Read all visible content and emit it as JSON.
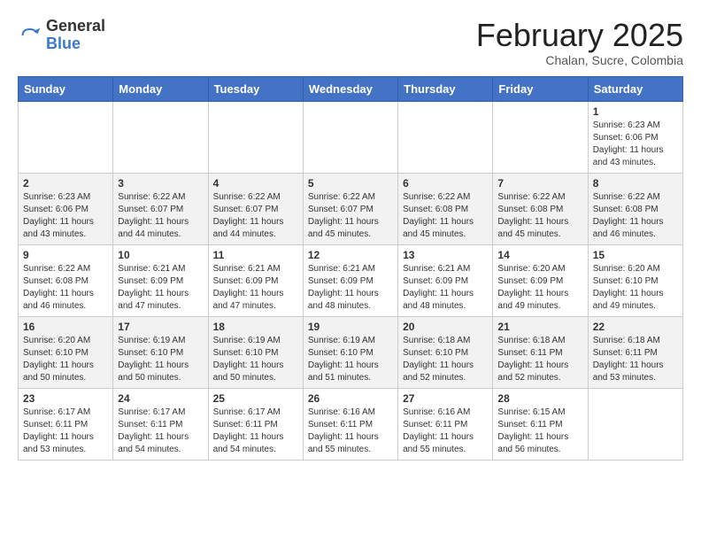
{
  "logo": {
    "general": "General",
    "blue": "Blue"
  },
  "header": {
    "month_year": "February 2025",
    "location": "Chalan, Sucre, Colombia"
  },
  "weekdays": [
    "Sunday",
    "Monday",
    "Tuesday",
    "Wednesday",
    "Thursday",
    "Friday",
    "Saturday"
  ],
  "weeks": [
    [
      {
        "day": "",
        "info": ""
      },
      {
        "day": "",
        "info": ""
      },
      {
        "day": "",
        "info": ""
      },
      {
        "day": "",
        "info": ""
      },
      {
        "day": "",
        "info": ""
      },
      {
        "day": "",
        "info": ""
      },
      {
        "day": "1",
        "info": "Sunrise: 6:23 AM\nSunset: 6:06 PM\nDaylight: 11 hours\nand 43 minutes."
      }
    ],
    [
      {
        "day": "2",
        "info": "Sunrise: 6:23 AM\nSunset: 6:06 PM\nDaylight: 11 hours\nand 43 minutes."
      },
      {
        "day": "3",
        "info": "Sunrise: 6:22 AM\nSunset: 6:07 PM\nDaylight: 11 hours\nand 44 minutes."
      },
      {
        "day": "4",
        "info": "Sunrise: 6:22 AM\nSunset: 6:07 PM\nDaylight: 11 hours\nand 44 minutes."
      },
      {
        "day": "5",
        "info": "Sunrise: 6:22 AM\nSunset: 6:07 PM\nDaylight: 11 hours\nand 45 minutes."
      },
      {
        "day": "6",
        "info": "Sunrise: 6:22 AM\nSunset: 6:08 PM\nDaylight: 11 hours\nand 45 minutes."
      },
      {
        "day": "7",
        "info": "Sunrise: 6:22 AM\nSunset: 6:08 PM\nDaylight: 11 hours\nand 45 minutes."
      },
      {
        "day": "8",
        "info": "Sunrise: 6:22 AM\nSunset: 6:08 PM\nDaylight: 11 hours\nand 46 minutes."
      }
    ],
    [
      {
        "day": "9",
        "info": "Sunrise: 6:22 AM\nSunset: 6:08 PM\nDaylight: 11 hours\nand 46 minutes."
      },
      {
        "day": "10",
        "info": "Sunrise: 6:21 AM\nSunset: 6:09 PM\nDaylight: 11 hours\nand 47 minutes."
      },
      {
        "day": "11",
        "info": "Sunrise: 6:21 AM\nSunset: 6:09 PM\nDaylight: 11 hours\nand 47 minutes."
      },
      {
        "day": "12",
        "info": "Sunrise: 6:21 AM\nSunset: 6:09 PM\nDaylight: 11 hours\nand 48 minutes."
      },
      {
        "day": "13",
        "info": "Sunrise: 6:21 AM\nSunset: 6:09 PM\nDaylight: 11 hours\nand 48 minutes."
      },
      {
        "day": "14",
        "info": "Sunrise: 6:20 AM\nSunset: 6:09 PM\nDaylight: 11 hours\nand 49 minutes."
      },
      {
        "day": "15",
        "info": "Sunrise: 6:20 AM\nSunset: 6:10 PM\nDaylight: 11 hours\nand 49 minutes."
      }
    ],
    [
      {
        "day": "16",
        "info": "Sunrise: 6:20 AM\nSunset: 6:10 PM\nDaylight: 11 hours\nand 50 minutes."
      },
      {
        "day": "17",
        "info": "Sunrise: 6:19 AM\nSunset: 6:10 PM\nDaylight: 11 hours\nand 50 minutes."
      },
      {
        "day": "18",
        "info": "Sunrise: 6:19 AM\nSunset: 6:10 PM\nDaylight: 11 hours\nand 50 minutes."
      },
      {
        "day": "19",
        "info": "Sunrise: 6:19 AM\nSunset: 6:10 PM\nDaylight: 11 hours\nand 51 minutes."
      },
      {
        "day": "20",
        "info": "Sunrise: 6:18 AM\nSunset: 6:10 PM\nDaylight: 11 hours\nand 52 minutes."
      },
      {
        "day": "21",
        "info": "Sunrise: 6:18 AM\nSunset: 6:11 PM\nDaylight: 11 hours\nand 52 minutes."
      },
      {
        "day": "22",
        "info": "Sunrise: 6:18 AM\nSunset: 6:11 PM\nDaylight: 11 hours\nand 53 minutes."
      }
    ],
    [
      {
        "day": "23",
        "info": "Sunrise: 6:17 AM\nSunset: 6:11 PM\nDaylight: 11 hours\nand 53 minutes."
      },
      {
        "day": "24",
        "info": "Sunrise: 6:17 AM\nSunset: 6:11 PM\nDaylight: 11 hours\nand 54 minutes."
      },
      {
        "day": "25",
        "info": "Sunrise: 6:17 AM\nSunset: 6:11 PM\nDaylight: 11 hours\nand 54 minutes."
      },
      {
        "day": "26",
        "info": "Sunrise: 6:16 AM\nSunset: 6:11 PM\nDaylight: 11 hours\nand 55 minutes."
      },
      {
        "day": "27",
        "info": "Sunrise: 6:16 AM\nSunset: 6:11 PM\nDaylight: 11 hours\nand 55 minutes."
      },
      {
        "day": "28",
        "info": "Sunrise: 6:15 AM\nSunset: 6:11 PM\nDaylight: 11 hours\nand 56 minutes."
      },
      {
        "day": "",
        "info": ""
      }
    ]
  ]
}
